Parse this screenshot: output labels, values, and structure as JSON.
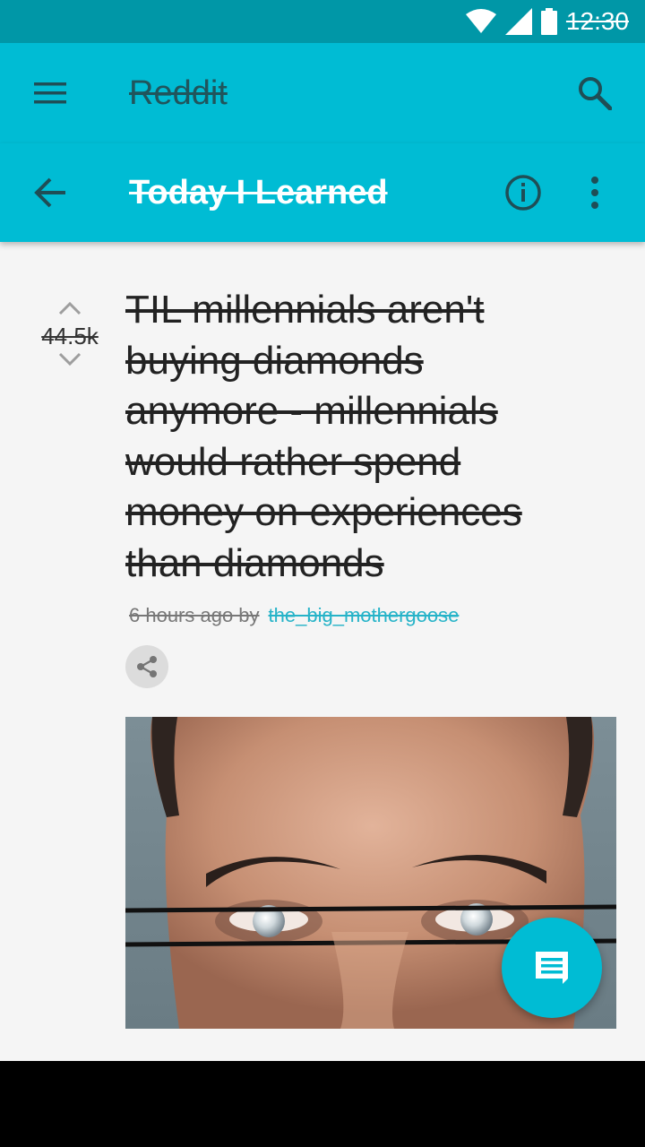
{
  "status_bar": {
    "time": "12:30",
    "icons": [
      "wifi-icon",
      "signal-icon",
      "battery-icon"
    ]
  },
  "app_bar": {
    "title": "Reddit",
    "menu_icon": "menu-icon",
    "search_icon": "search-icon"
  },
  "sub_bar": {
    "title": "Today I Learned",
    "back_icon": "back-arrow-icon",
    "info_icon": "info-icon",
    "more_icon": "more-vert-icon"
  },
  "post": {
    "score": "44.5k",
    "title": "TIL millennials aren't buying diamonds anymore - millennials would rather spend money on experiences than diamonds",
    "time": "6 hours ago by",
    "author": "the_big_mothergoose"
  },
  "fab": {
    "icon": "comment-icon"
  },
  "colors": {
    "primary": "#00bcd4",
    "primary_dark": "#0097a7",
    "accent_link": "#26b3c8",
    "background": "#f5f5f5"
  }
}
